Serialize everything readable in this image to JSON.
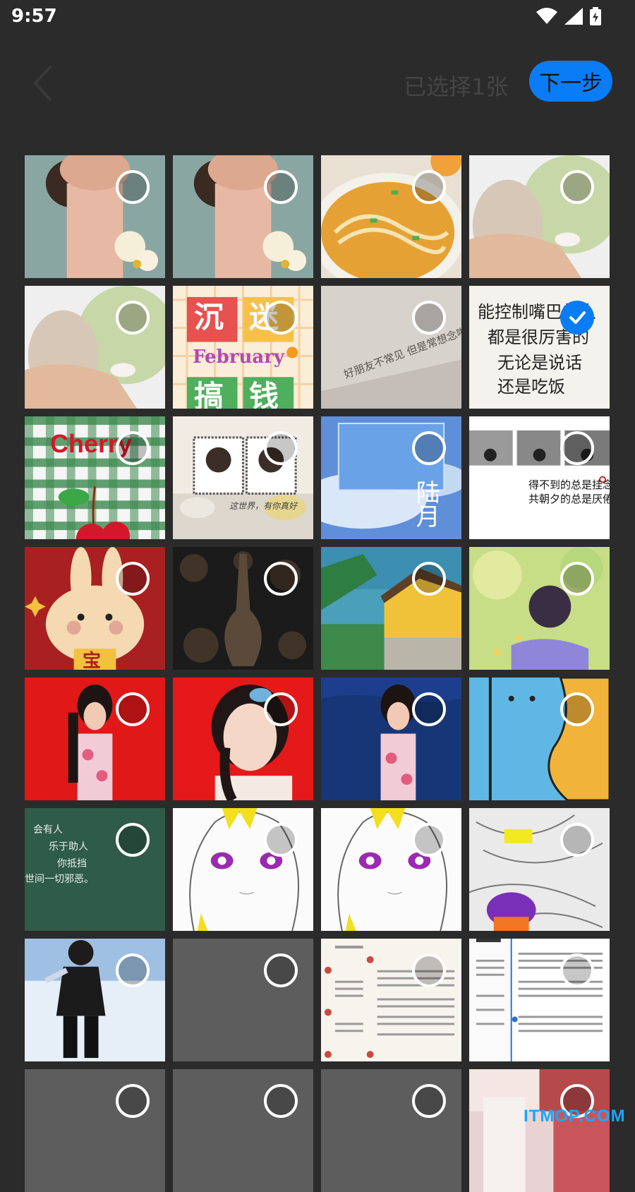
{
  "status_bar": {
    "time": "9:57"
  },
  "header": {
    "title": "已选择1张",
    "next_label": "下一步"
  },
  "tiles": [
    {
      "theme": "portrait-flowers"
    },
    {
      "theme": "portrait-flowers"
    },
    {
      "theme": "noodle-soup"
    },
    {
      "theme": "green-dessert"
    },
    {
      "theme": "green-dessert"
    },
    {
      "theme": "february-poster",
      "text": [
        "沉",
        "迷",
        "February",
        "搞",
        "钱"
      ]
    },
    {
      "theme": "paper-text",
      "text": [
        "好朋友不常见 但是常想念啦"
      ]
    },
    {
      "theme": "handwriting",
      "checked": true,
      "text": [
        "能控制嘴巴的人",
        "都是很厉害的",
        "无论是说话",
        "还是吃饭"
      ]
    },
    {
      "theme": "cherry",
      "text": [
        "Cherry"
      ]
    },
    {
      "theme": "couple-frames",
      "text": [
        "这世界，有你真好"
      ]
    },
    {
      "theme": "sky",
      "text": [
        "陆月"
      ]
    },
    {
      "theme": "bw-quote",
      "text": [
        "得不到的总是挂念",
        "共朝夕的总是厌倦"
      ]
    },
    {
      "theme": "rabbit",
      "text": [
        "宝"
      ]
    },
    {
      "theme": "dark-guitar"
    },
    {
      "theme": "house"
    },
    {
      "theme": "fantasy-girl"
    },
    {
      "theme": "red-woman"
    },
    {
      "theme": "red-portrait"
    },
    {
      "theme": "ocean-woman"
    },
    {
      "theme": "cartoon-blue"
    },
    {
      "theme": "green-text",
      "text": [
        "会有人",
        "乐于助人",
        "你抵挡",
        "世间一切邪恶。"
      ]
    },
    {
      "theme": "anime-girl"
    },
    {
      "theme": "anime-girl"
    },
    {
      "theme": "sketch-color"
    },
    {
      "theme": "snow-person"
    },
    {
      "theme": "blank"
    },
    {
      "theme": "resume-a"
    },
    {
      "theme": "resume-b"
    },
    {
      "theme": "blank"
    },
    {
      "theme": "blank"
    },
    {
      "theme": "blank"
    },
    {
      "theme": "pink-photo"
    }
  ],
  "watermark": "ITMOP.COM",
  "colors": {
    "accent": "#0a7cf5",
    "background": "#2b2b2b"
  }
}
